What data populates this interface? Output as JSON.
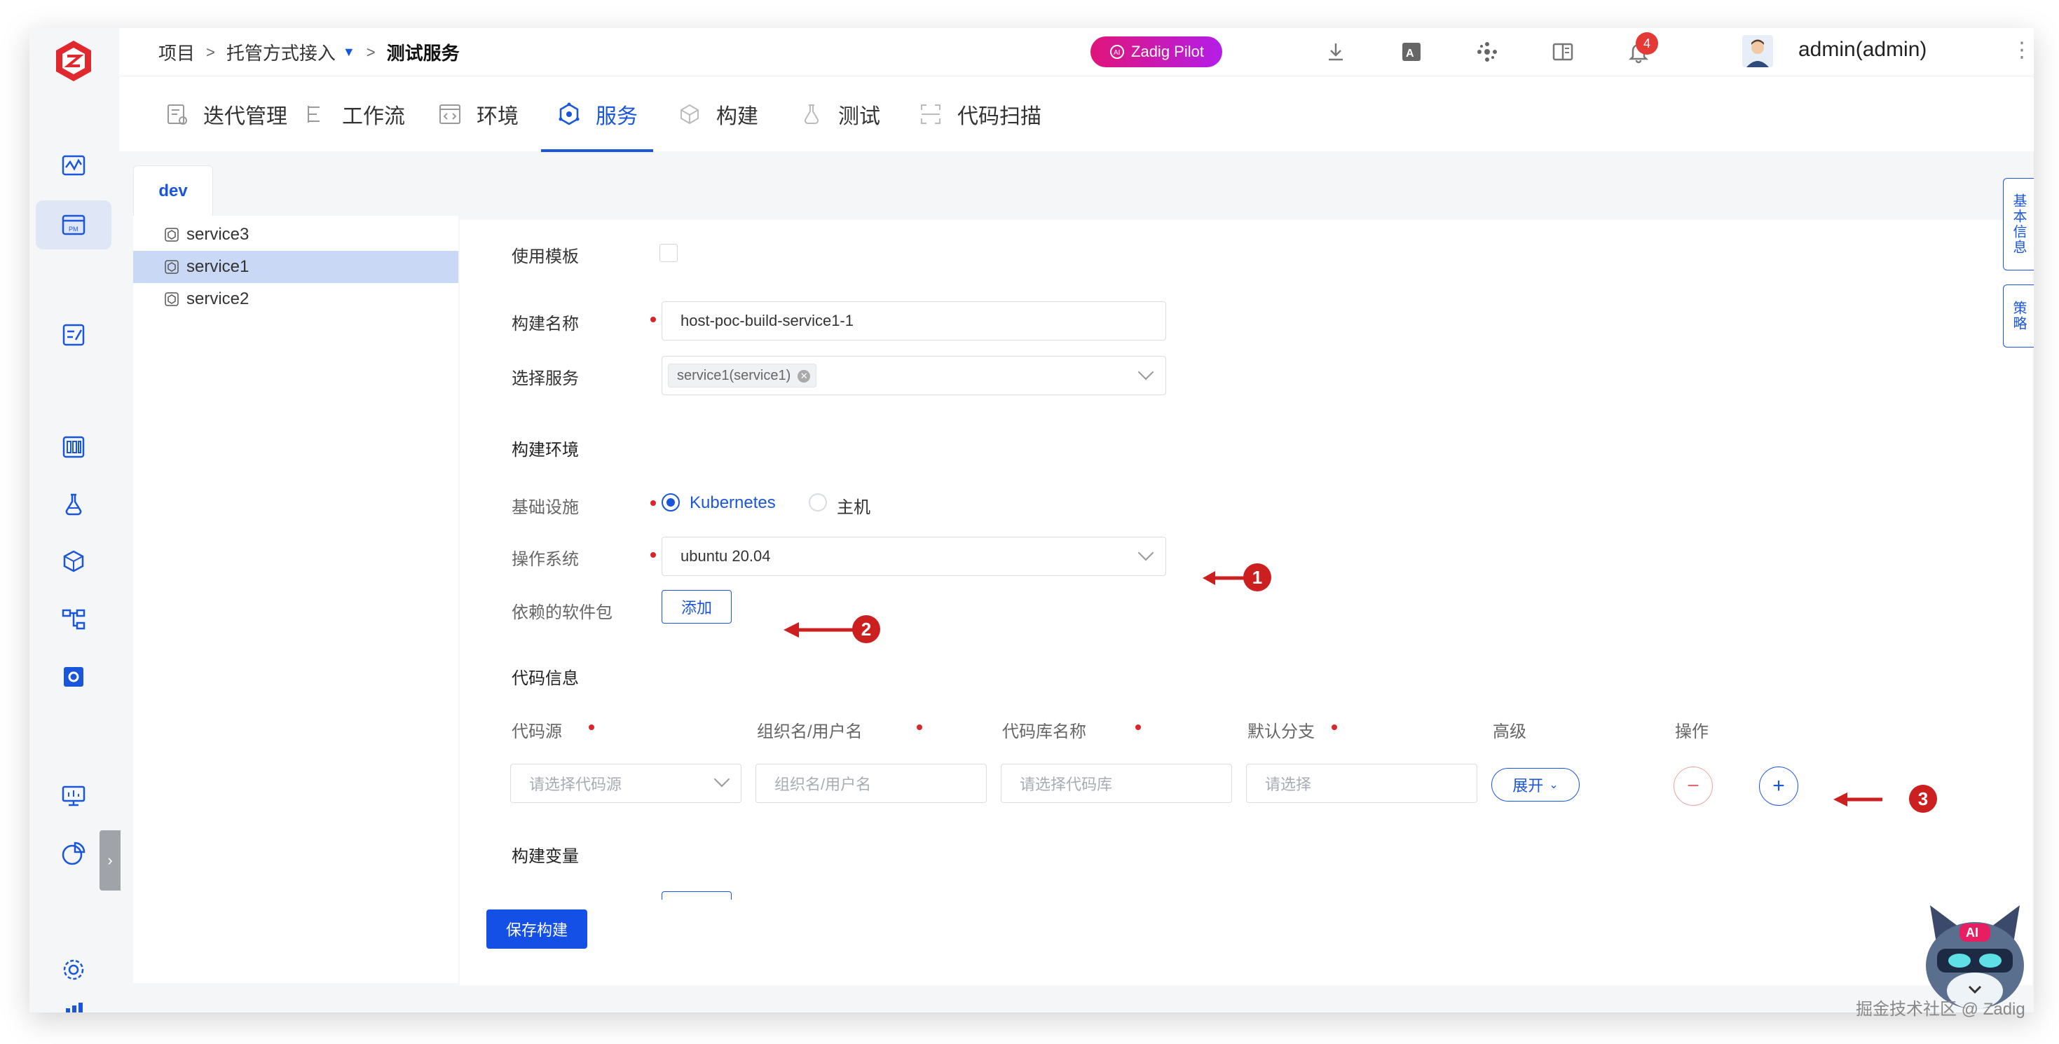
{
  "breadcrumb": {
    "items": [
      "项目",
      "托管方式接入",
      "测试服务"
    ],
    "separator": ">"
  },
  "topbar": {
    "pilot_label": "Zadig Pilot",
    "notifications_count": "4",
    "username": "admin(admin)",
    "more": "⋮"
  },
  "navtabs": [
    {
      "label": "迭代管理",
      "icon": "iteration-icon"
    },
    {
      "label": "工作流",
      "icon": "workflow-icon"
    },
    {
      "label": "环境",
      "icon": "environment-icon"
    },
    {
      "label": "服务",
      "icon": "service-icon",
      "active": true
    },
    {
      "label": "构建",
      "icon": "build-icon"
    },
    {
      "label": "测试",
      "icon": "test-icon"
    },
    {
      "label": "代码扫描",
      "icon": "code-scan-icon"
    }
  ],
  "env_tab": "dev",
  "services": [
    {
      "name": "service3"
    },
    {
      "name": "service1",
      "active": true
    },
    {
      "name": "service2"
    }
  ],
  "form": {
    "use_template_label": "使用模板",
    "build_name_label": "构建名称",
    "build_name_value": "host-poc-build-service1-1",
    "select_service_label": "选择服务",
    "selected_service_tag": "service1(service1)",
    "build_env_title": "构建环境",
    "infra_label": "基础设施",
    "infra_options": [
      "Kubernetes",
      "主机"
    ],
    "infra_selected": "Kubernetes",
    "os_label": "操作系统",
    "os_value": "ubuntu 20.04",
    "deps_label": "依赖的软件包",
    "deps_add_button": "添加",
    "code_info_title": "代码信息",
    "code_columns": [
      "代码源",
      "组织名/用户名",
      "代码库名称",
      "默认分支",
      "高级",
      "操作"
    ],
    "code_placeholders": {
      "source": "请选择代码源",
      "org": "组织名/用户名",
      "repo": "请选择代码库",
      "branch": "请选择"
    },
    "expand_button": "展开",
    "build_vars_title": "构建变量",
    "save_button": "保存构建"
  },
  "side_tabs": [
    "基本信息",
    "策略"
  ],
  "annotations": [
    "1",
    "2",
    "3"
  ],
  "watermark": "掘金技术社区 @ Zadig",
  "mascot_badge": "AI",
  "colors": {
    "primary": "#1a56db",
    "required": "#d9262c",
    "annotation": "#cc1f1f",
    "pilot_gradient_start": "#e0157a",
    "pilot_gradient_end": "#b31ee8",
    "selected_row": "#c8d8f5"
  }
}
